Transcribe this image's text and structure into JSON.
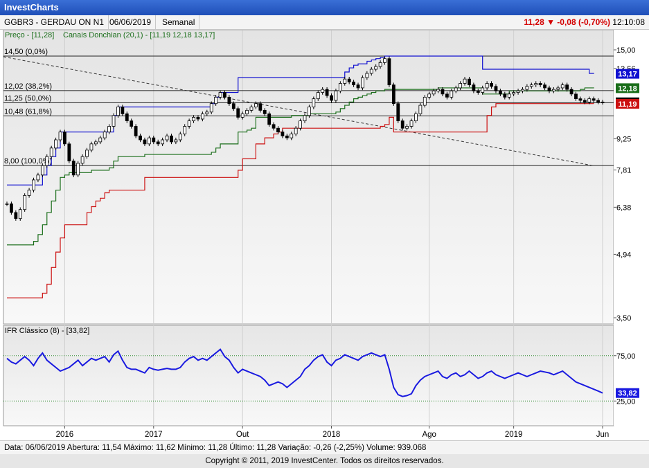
{
  "app": {
    "title": "InvestCharts"
  },
  "header": {
    "ticker": "GGBR3 - GERDAU ON N1",
    "date": "06/06/2019",
    "period": "Semanal",
    "quote": "11,28 ▼ -0,08 (-0,70%)",
    "time": "12:10:08"
  },
  "legend": {
    "price": "Preço - [11,28]",
    "donchian": "Canais Donchian (20,1) - [11,19  12,18  13,17]"
  },
  "fib": [
    {
      "label": "14,50 (0,0%)",
      "value": 14.5
    },
    {
      "label": "12,02 (38,2%)",
      "value": 12.02
    },
    {
      "label": "11,25 (50,0%)",
      "value": 11.25
    },
    {
      "label": "10,48 (61,8%)",
      "value": 10.48
    },
    {
      "label": "8,00 (100,0%)",
      "value": 8.0
    }
  ],
  "price_axis": {
    "ticks": [
      {
        "label": "15,00",
        "value": 15.0
      },
      {
        "label": "13,56",
        "value": 13.56
      },
      {
        "label": "9,25",
        "value": 9.25
      },
      {
        "label": "7,81",
        "value": 7.81
      },
      {
        "label": "6,38",
        "value": 6.38
      },
      {
        "label": "4,94",
        "value": 4.94
      },
      {
        "label": "3,50",
        "value": 3.5
      }
    ],
    "badges": [
      {
        "label": "13,17",
        "value": 13.17,
        "color": "#1010d0"
      },
      {
        "label": "12,18",
        "value": 12.18,
        "color": "#1a6e1a"
      },
      {
        "label": "11,28",
        "value": 11.28,
        "color": "#000000"
      },
      {
        "label": "11,19",
        "value": 11.19,
        "color": "#cc1111"
      }
    ]
  },
  "rsi": {
    "title": "IFR Clássico (8) - [33,82]",
    "ticks": [
      {
        "label": "75,00",
        "value": 75
      },
      {
        "label": "25,00",
        "value": 25
      }
    ],
    "badge": "33,82"
  },
  "time_axis": {
    "ticks": [
      {
        "label": "2016",
        "index": 13
      },
      {
        "label": "2017",
        "index": 33
      },
      {
        "label": "Out",
        "index": 53
      },
      {
        "label": "2018",
        "index": 73
      },
      {
        "label": "Ago",
        "index": 95
      },
      {
        "label": "2019",
        "index": 114
      },
      {
        "label": "Jun",
        "index": 134
      }
    ]
  },
  "footer": {
    "text": "Data: 06/06/2019   Abertura: 11,54   Máximo: 11,62   Mínimo: 11,28   Último: 11,28   Variação: -0,26 (-2,25%)   Volume: 939.068"
  },
  "copyright": "Copyright © 2011, 2019  InvestCenter. Todos os direitos reservados.",
  "colors": {
    "upper_channel": "#1010d0",
    "middle_channel": "#1a6e1a",
    "lower_channel": "#cc1111",
    "rsi_line": "#1a1ae0",
    "quote": "#d40000"
  },
  "chart_data": {
    "type": "line",
    "x_count": 135,
    "ylim": [
      3.5,
      15.0
    ],
    "rsi_ylim": [
      0,
      100
    ],
    "series": [
      {
        "values": [
          6.5,
          6.2,
          6.0,
          6.3,
          6.8,
          7.0,
          7.4,
          7.6,
          8.0,
          8.4,
          8.8,
          9.2,
          9.6,
          9.0,
          8.2,
          7.6,
          8.1,
          8.4,
          8.7,
          9.0,
          9.1,
          9.3,
          9.6,
          9.9,
          10.5,
          11.0,
          10.6,
          10.2,
          9.9,
          9.4,
          9.2,
          9.0,
          9.3,
          9.1,
          9.0,
          9.2,
          9.4,
          9.1,
          9.2,
          9.5,
          9.9,
          10.2,
          10.4,
          10.3,
          10.6,
          10.7,
          11.2,
          11.6,
          11.9,
          11.6,
          11.2,
          10.9,
          10.4,
          10.6,
          10.8,
          11.0,
          11.2,
          10.8,
          10.6,
          10.0,
          9.8,
          9.6,
          9.4,
          9.3,
          9.5,
          9.8,
          10.2,
          10.5,
          11.0,
          11.5,
          11.9,
          12.1,
          11.7,
          11.4,
          12.0,
          12.5,
          12.8,
          12.6,
          12.4,
          12.2,
          12.9,
          13.2,
          13.5,
          13.7,
          14.0,
          14.3,
          12.4,
          11.2,
          10.2,
          9.8,
          9.9,
          10.2,
          10.6,
          11.1,
          11.6,
          11.8,
          12.0,
          12.1,
          11.8,
          11.6,
          12.0,
          12.2,
          12.5,
          12.8,
          12.4,
          12.0,
          11.9,
          12.2,
          12.5,
          12.3,
          12.0,
          11.8,
          11.6,
          11.8,
          11.9,
          12.0,
          12.1,
          12.3,
          12.4,
          12.5,
          12.4,
          12.2,
          12.0,
          12.1,
          12.2,
          12.4,
          12.1,
          11.8,
          11.5,
          11.4,
          11.3,
          11.5,
          11.4,
          11.3,
          11.28
        ]
      },
      {
        "values": [
          7.2,
          7.2,
          7.2,
          7.2,
          7.2,
          7.2,
          7.2,
          7.2,
          7.6,
          8.0,
          8.4,
          8.8,
          9.6,
          9.6,
          9.6,
          9.6,
          9.6,
          9.6,
          9.6,
          9.6,
          9.6,
          9.6,
          9.6,
          9.6,
          10.5,
          11.0,
          11.0,
          11.0,
          11.0,
          11.0,
          11.0,
          11.0,
          11.0,
          11.0,
          11.0,
          11.0,
          11.0,
          11.0,
          11.0,
          11.0,
          11.0,
          11.0,
          11.0,
          11.0,
          11.0,
          11.0,
          11.2,
          11.6,
          11.9,
          11.9,
          11.9,
          11.9,
          12.9,
          12.9,
          12.9,
          12.9,
          12.9,
          12.9,
          12.9,
          12.9,
          12.9,
          12.9,
          12.9,
          12.9,
          12.9,
          12.9,
          12.9,
          12.9,
          12.9,
          12.9,
          12.9,
          12.9,
          12.9,
          12.9,
          12.9,
          12.9,
          13.3,
          13.6,
          13.8,
          13.9,
          13.9,
          14.1,
          14.2,
          14.3,
          14.4,
          14.5,
          14.5,
          14.5,
          14.5,
          14.5,
          14.5,
          14.5,
          14.5,
          14.5,
          14.5,
          14.5,
          14.5,
          14.5,
          14.5,
          14.5,
          14.5,
          14.5,
          14.5,
          14.5,
          14.5,
          14.5,
          14.5,
          13.5,
          13.5,
          13.5,
          13.5,
          13.5,
          13.5,
          13.5,
          13.5,
          13.5,
          13.5,
          13.5,
          13.5,
          13.5,
          13.5,
          13.5,
          13.5,
          13.5,
          13.5,
          13.5,
          13.5,
          13.5,
          13.5,
          13.5,
          13.5,
          13.2,
          13.17
        ]
      },
      {
        "values": [
          5.2,
          5.2,
          5.2,
          5.2,
          5.2,
          5.2,
          5.3,
          5.5,
          5.8,
          6.2,
          6.6,
          7.0,
          7.5,
          7.6,
          7.7,
          7.7,
          7.7,
          7.7,
          7.7,
          7.8,
          7.8,
          7.8,
          7.8,
          7.9,
          8.2,
          8.4,
          8.4,
          8.4,
          8.4,
          8.4,
          8.4,
          8.5,
          8.5,
          8.5,
          8.5,
          8.5,
          8.5,
          8.5,
          8.5,
          8.5,
          8.5,
          8.5,
          8.5,
          8.5,
          8.5,
          8.5,
          8.6,
          8.8,
          9.0,
          9.0,
          9.0,
          9.0,
          9.6,
          9.6,
          9.7,
          9.8,
          10.4,
          10.4,
          10.4,
          10.4,
          10.4,
          10.4,
          10.4,
          10.4,
          10.5,
          10.5,
          10.5,
          10.5,
          10.6,
          10.6,
          10.6,
          10.6,
          10.6,
          10.6,
          10.7,
          10.9,
          11.1,
          11.3,
          11.5,
          11.6,
          11.7,
          11.8,
          11.9,
          12.0,
          12.0,
          12.1,
          12.1,
          12.1,
          12.1,
          12.1,
          12.1,
          12.1,
          12.1,
          12.1,
          12.1,
          12.1,
          12.1,
          12.2,
          12.2,
          12.2,
          12.2,
          12.2,
          12.2,
          12.2,
          12.2,
          12.2,
          12.2,
          11.8,
          11.8,
          11.8,
          11.8,
          11.8,
          11.8,
          12.0,
          12.0,
          12.0,
          12.0,
          12.0,
          12.0,
          12.0,
          12.0,
          12.0,
          12.0,
          12.0,
          12.0,
          12.0,
          12.0,
          12.0,
          12.0,
          12.1,
          12.2,
          12.2,
          12.18
        ]
      },
      {
        "values": [
          3.9,
          3.9,
          3.9,
          3.9,
          3.9,
          3.9,
          3.9,
          3.9,
          4.0,
          4.2,
          4.6,
          5.0,
          5.4,
          5.8,
          5.8,
          5.8,
          5.8,
          5.8,
          6.2,
          6.4,
          6.6,
          6.7,
          6.9,
          7.0,
          7.0,
          7.0,
          7.0,
          7.0,
          7.0,
          7.0,
          7.0,
          7.5,
          7.5,
          7.5,
          7.5,
          7.5,
          7.5,
          7.5,
          7.5,
          7.5,
          7.5,
          7.5,
          7.5,
          7.5,
          7.5,
          7.5,
          7.5,
          7.5,
          7.5,
          7.5,
          7.5,
          7.5,
          7.8,
          8.3,
          8.3,
          8.3,
          9.0,
          9.0,
          9.3,
          9.3,
          9.5,
          9.6,
          9.8,
          9.8,
          9.8,
          9.8,
          9.8,
          9.8,
          9.8,
          9.8,
          9.8,
          9.8,
          9.8,
          9.8,
          9.8,
          9.8,
          9.8,
          9.8,
          9.8,
          9.8,
          9.8,
          9.8,
          9.8,
          9.8,
          9.9,
          10.0,
          10.4,
          9.6,
          9.6,
          9.6,
          9.6,
          9.6,
          9.6,
          9.6,
          9.6,
          9.6,
          9.6,
          9.6,
          9.6,
          9.6,
          9.6,
          9.6,
          9.6,
          9.6,
          9.6,
          9.6,
          9.6,
          9.6,
          10.5,
          11.0,
          11.2,
          11.2,
          11.2,
          11.2,
          11.2,
          11.2,
          11.2,
          11.2,
          11.2,
          11.2,
          11.2,
          11.2,
          11.2,
          11.2,
          11.2,
          11.2,
          11.2,
          11.2,
          11.2,
          11.2,
          11.2,
          11.2,
          11.19
        ]
      },
      {
        "values": [
          72,
          68,
          66,
          70,
          74,
          70,
          64,
          72,
          78,
          70,
          66,
          62,
          58,
          60,
          62,
          66,
          70,
          64,
          68,
          72,
          70,
          72,
          74,
          68,
          76,
          80,
          70,
          62,
          60,
          60,
          58,
          56,
          62,
          60,
          59,
          60,
          61,
          60,
          60,
          62,
          68,
          72,
          74,
          70,
          72,
          70,
          74,
          78,
          82,
          74,
          70,
          62,
          56,
          60,
          58,
          56,
          54,
          52,
          48,
          42,
          44,
          46,
          44,
          40,
          44,
          48,
          52,
          60,
          64,
          70,
          74,
          76,
          68,
          64,
          70,
          72,
          76,
          74,
          72,
          70,
          74,
          76,
          78,
          76,
          74,
          76,
          60,
          40,
          32,
          30,
          31,
          33,
          42,
          48,
          52,
          54,
          56,
          58,
          52,
          50,
          54,
          56,
          52,
          54,
          58,
          54,
          50,
          52,
          56,
          58,
          54,
          52,
          50,
          52,
          54,
          56,
          54,
          52,
          54,
          56,
          58,
          57,
          56,
          54,
          56,
          58,
          54,
          50,
          46,
          44,
          42,
          40,
          38,
          36,
          33.82
        ]
      }
    ]
  }
}
